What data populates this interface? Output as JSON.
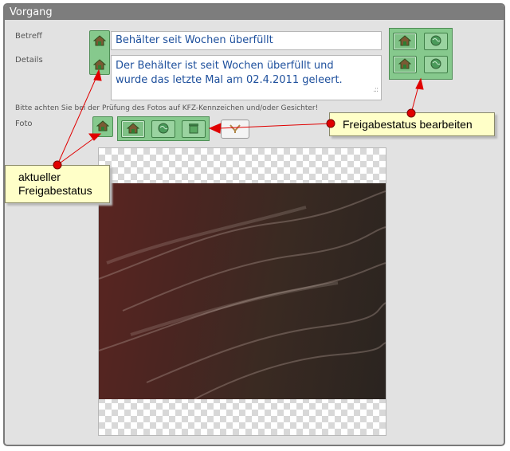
{
  "panel": {
    "title": "Vorgang"
  },
  "labels": {
    "betreff": "Betreff",
    "details": "Details",
    "hint": "Bitte achten Sie bei der Prüfung des Fotos auf KFZ-Kennzeichen und/oder Gesichter!",
    "foto": "Foto"
  },
  "fields": {
    "betreff": "Behälter seit Wochen überfüllt",
    "details": "Der Behälter ist seit Wochen überfüllt und wurde das letzte Mal am 02.4.2011 geleert."
  },
  "callouts": {
    "freigabe_bearbeiten": "Freigabestatus bearbeiten",
    "aktueller_status_line1": "aktueller",
    "aktueller_status_line2": "Freigabestatus"
  },
  "icons": {
    "status": "home-icon",
    "internal": "home-icon",
    "public": "globe-icon",
    "archive": "archive-icon",
    "delete": "rotate-icon"
  },
  "colors": {
    "button_green": "#86c98d",
    "annotation_red": "#e00000",
    "callout_bg": "#ffffc8",
    "text_blue": "#1d4f9c"
  }
}
